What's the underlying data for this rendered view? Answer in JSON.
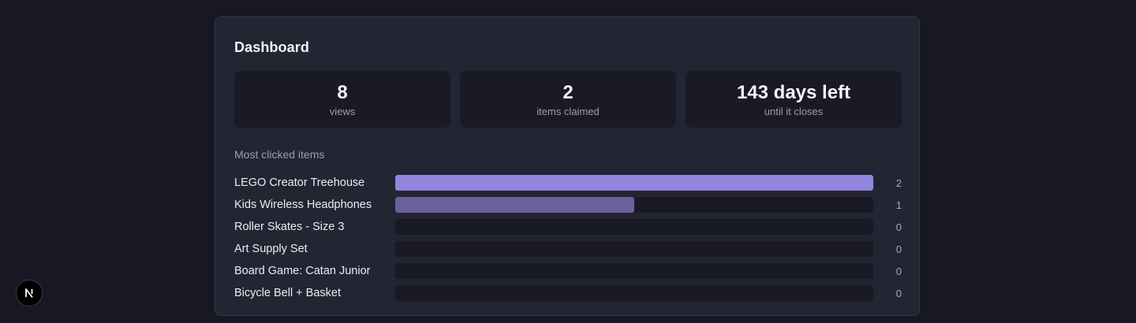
{
  "dashboard": {
    "title": "Dashboard",
    "stats": [
      {
        "value": "8",
        "label": "views"
      },
      {
        "value": "2",
        "label": "items claimed"
      },
      {
        "value": "143 days left",
        "label": "until it closes"
      }
    ],
    "most_clicked_label": "Most clicked items",
    "items": [
      {
        "name": "LEGO Creator Treehouse",
        "count": "2",
        "fraction": 1.0
      },
      {
        "name": "Kids Wireless Headphones",
        "count": "1",
        "fraction": 0.5
      },
      {
        "name": "Roller Skates - Size 3",
        "count": "0",
        "fraction": 0
      },
      {
        "name": "Art Supply Set",
        "count": "0",
        "fraction": 0
      },
      {
        "name": "Board Game: Catan Junior",
        "count": "0",
        "fraction": 0
      },
      {
        "name": "Bicycle Bell + Basket",
        "count": "0",
        "fraction": 0
      }
    ]
  },
  "colors": {
    "background": "#181825",
    "card": "#242533",
    "bar_primary": "#9185de",
    "bar_secondary": "#6a6198"
  },
  "badge": {
    "icon": "nextjs-n-icon"
  }
}
